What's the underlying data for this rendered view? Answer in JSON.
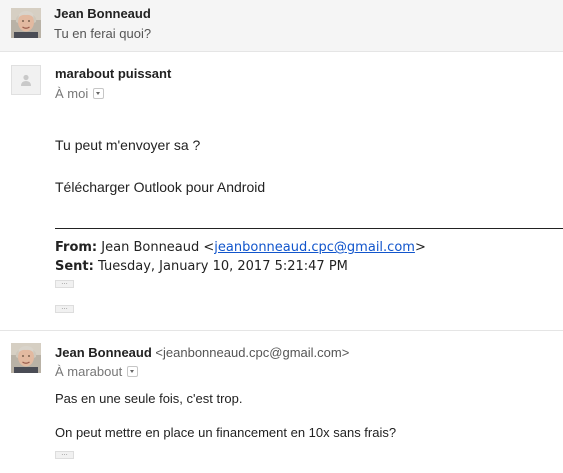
{
  "thread": {
    "messages": [
      {
        "sender": "Jean Bonneaud",
        "snippet": "Tu en ferai quoi?"
      },
      {
        "sender": "marabout puissant",
        "to": "À moi",
        "body": [
          "Tu peut m'envoyer sa ?",
          "Télécharger Outlook pour Android"
        ],
        "quoted": {
          "from_label": "From:",
          "from_name": "Jean Bonneaud <",
          "from_email": "jeanbonneaud.cpc@gmail.com",
          "from_close": ">",
          "sent_label": "Sent:",
          "sent_value": "Tuesday, January 10, 2017 5:21:47 PM"
        }
      },
      {
        "sender": "Jean Bonneaud",
        "sender_email": "<jeanbonneaud.cpc@gmail.com>",
        "to": "À marabout",
        "body": [
          "Pas en une seule fois, c'est trop.",
          "On peut mettre en place un financement en 10x sans frais?"
        ]
      }
    ]
  },
  "icons": {
    "person_photo": "person-photo-avatar",
    "generic_avatar": "person-silhouette-icon",
    "dropdown": "chevron-down-icon",
    "show_trimmed": "ellipsis-icon"
  },
  "colors": {
    "link": "#1155cc",
    "collapsed_bg": "#f5f5f5",
    "divider": "#e5e5e5"
  }
}
